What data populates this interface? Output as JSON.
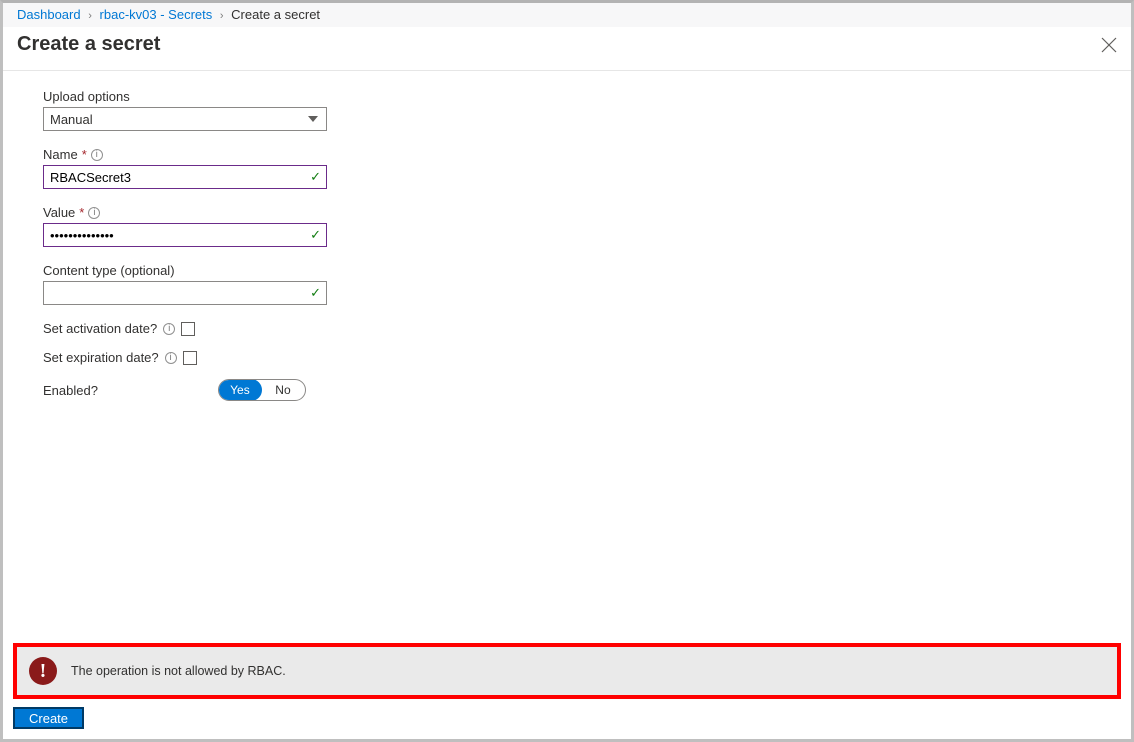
{
  "breadcrumb": {
    "items": [
      {
        "label": "Dashboard",
        "link": true
      },
      {
        "label": "rbac-kv03 - Secrets",
        "link": true
      },
      {
        "label": "Create a secret",
        "link": false
      }
    ]
  },
  "header": {
    "title": "Create a secret"
  },
  "form": {
    "upload_options": {
      "label": "Upload options",
      "value": "Manual"
    },
    "name": {
      "label": "Name",
      "value": "RBACSecret3"
    },
    "value": {
      "label": "Value",
      "masked": "••••••••••••••"
    },
    "content_type": {
      "label": "Content type (optional)",
      "value": ""
    },
    "activation": {
      "label": "Set activation date?"
    },
    "expiration": {
      "label": "Set expiration date?"
    },
    "enabled": {
      "label": "Enabled?",
      "yes": "Yes",
      "no": "No",
      "selected": "Yes"
    }
  },
  "error": {
    "message": "The operation is not allowed by RBAC."
  },
  "footer": {
    "create_label": "Create"
  }
}
